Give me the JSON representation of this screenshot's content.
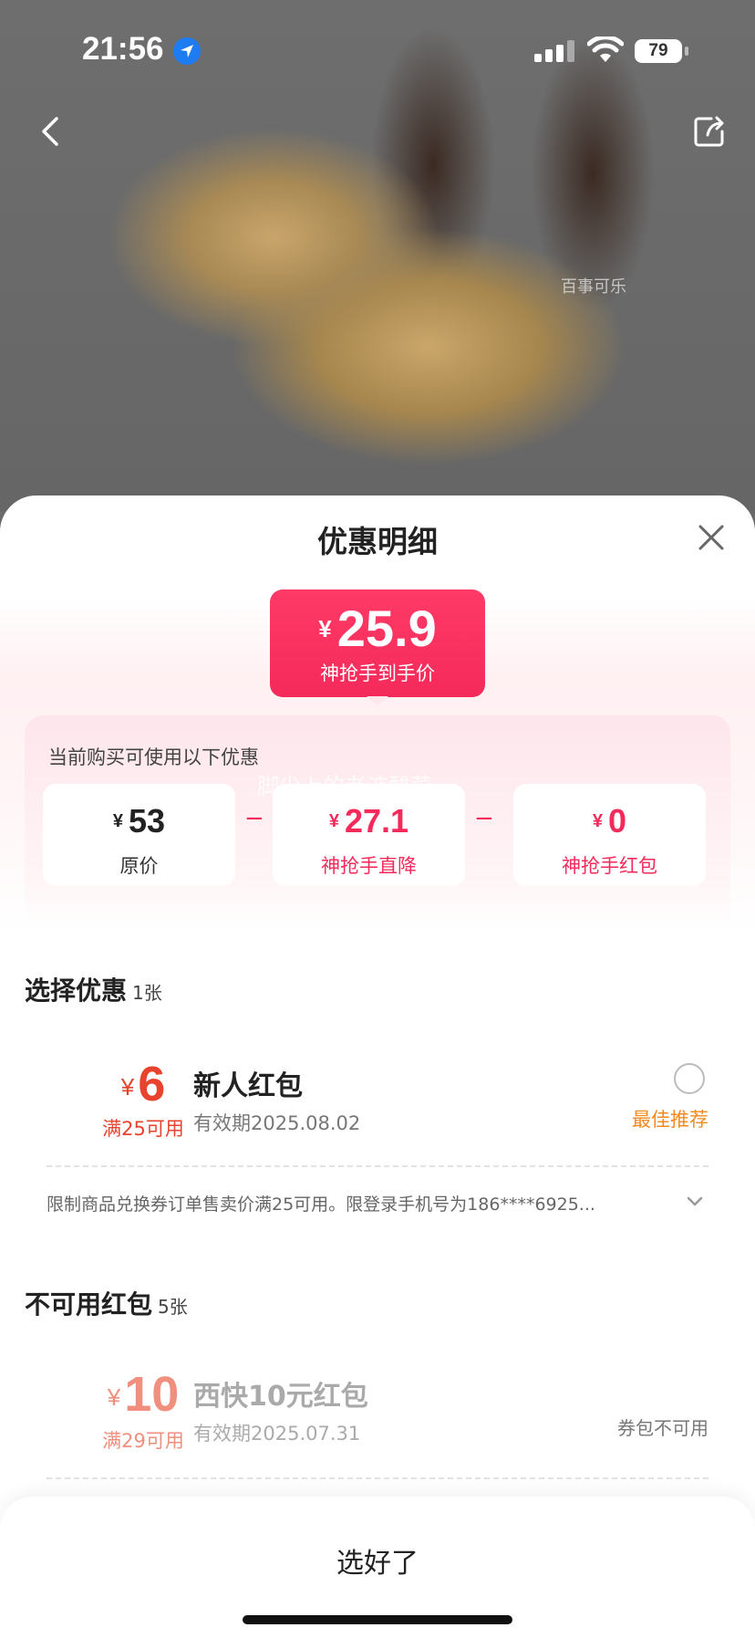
{
  "status_bar": {
    "time": "21:56",
    "battery": "79"
  },
  "hero": {
    "cup_label": "百事可乐"
  },
  "sheet": {
    "title": "优惠明细",
    "final_price": {
      "currency": "¥",
      "value": "25.9",
      "label": "神抢手到手价"
    },
    "discount_caption": "当前购买可使用以下优惠",
    "watermark_text": "脚尖上的老液酸菜",
    "breakdown": [
      {
        "currency": "¥",
        "amount": "53",
        "label": "原价"
      },
      {
        "currency": "¥",
        "amount": "27.1",
        "label": "神抢手直降"
      },
      {
        "currency": "¥",
        "amount": "0",
        "label": "神抢手红包"
      }
    ],
    "operator": "−"
  },
  "select_section": {
    "title": "选择优惠",
    "count": "1张"
  },
  "available_coupon": {
    "currency": "¥",
    "amount": "6",
    "condition": "满25可用",
    "name": "新人红包",
    "validity": "有效期2025.08.02",
    "tag": "最佳推荐",
    "rule": "限制商品兑换券订单售卖价满25可用。限登录手机号为186****6925..."
  },
  "unavailable_section": {
    "title": "不可用红包",
    "count": "5张"
  },
  "unavailable_coupon": {
    "currency": "¥",
    "amount": "10",
    "condition": "满29可用",
    "name": "西快10元红包",
    "validity": "有效期2025.07.31",
    "status": "券包不可用"
  },
  "bottom": {
    "confirm_label": "选好了"
  },
  "colors": {
    "accent": "#f42a5b",
    "orange": "#f28a1f",
    "coupon_red": "#e8432e"
  }
}
